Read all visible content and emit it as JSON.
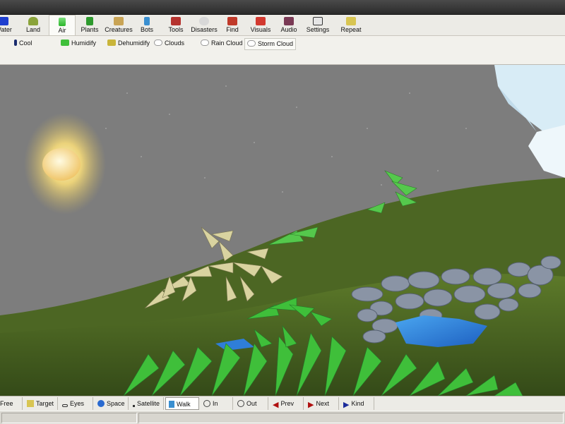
{
  "toolbar": {
    "tabs": [
      {
        "label": "Water",
        "icon": "water-icon"
      },
      {
        "label": "Land",
        "icon": "land-icon"
      },
      {
        "label": "Air",
        "icon": "air-icon",
        "active": true
      },
      {
        "label": "Plants",
        "icon": "plants-icon"
      },
      {
        "label": "Creatures",
        "icon": "creatures-icon"
      },
      {
        "label": "Bots",
        "icon": "bots-icon"
      },
      {
        "label": "Tools",
        "icon": "tools-icon"
      },
      {
        "label": "Disasters",
        "icon": "disasters-icon"
      },
      {
        "label": "Find",
        "icon": "find-icon"
      },
      {
        "label": "Visuals",
        "icon": "visuals-icon"
      },
      {
        "label": "Audio",
        "icon": "audio-icon"
      },
      {
        "label": "Settings",
        "icon": "settings-icon"
      },
      {
        "label": "Repeat",
        "icon": "repeat-icon"
      }
    ]
  },
  "subtoolbar": {
    "items": [
      {
        "label": "Cool",
        "icon": "thermometer-icon"
      },
      {
        "label": "Humidify",
        "icon": "humidify-icon"
      },
      {
        "label": "Dehumidify",
        "icon": "dehumidify-icon"
      },
      {
        "label": "Clouds",
        "icon": "cloud-icon"
      },
      {
        "label": "Rain Cloud",
        "icon": "rain-cloud-icon"
      },
      {
        "label": "Storm Cloud",
        "icon": "storm-cloud-icon",
        "active": true
      }
    ]
  },
  "camera_bar": {
    "buttons": [
      {
        "label": "Free",
        "icon": "free-camera-icon"
      },
      {
        "label": "Target",
        "icon": "target-icon"
      },
      {
        "label": "Eyes",
        "icon": "eyes-icon"
      },
      {
        "label": "Space",
        "icon": "space-icon"
      },
      {
        "label": "Satellite",
        "icon": "satellite-icon"
      },
      {
        "label": "Walk",
        "icon": "walk-icon",
        "active": true
      },
      {
        "label": "In",
        "icon": "zoom-in-icon"
      },
      {
        "label": "Out",
        "icon": "zoom-out-icon"
      },
      {
        "label": "Prev",
        "icon": "prev-arrow-icon"
      },
      {
        "label": "Next",
        "icon": "next-arrow-icon"
      },
      {
        "label": "Kind",
        "icon": "kind-arrow-icon"
      }
    ]
  },
  "colors": {
    "sky": "#7c7c7c",
    "sun": "#ffe79a",
    "grass": "#4f6a22",
    "fern": "#3fbf3a",
    "water": "#2f7ed8",
    "rock": "#8a93a3"
  }
}
